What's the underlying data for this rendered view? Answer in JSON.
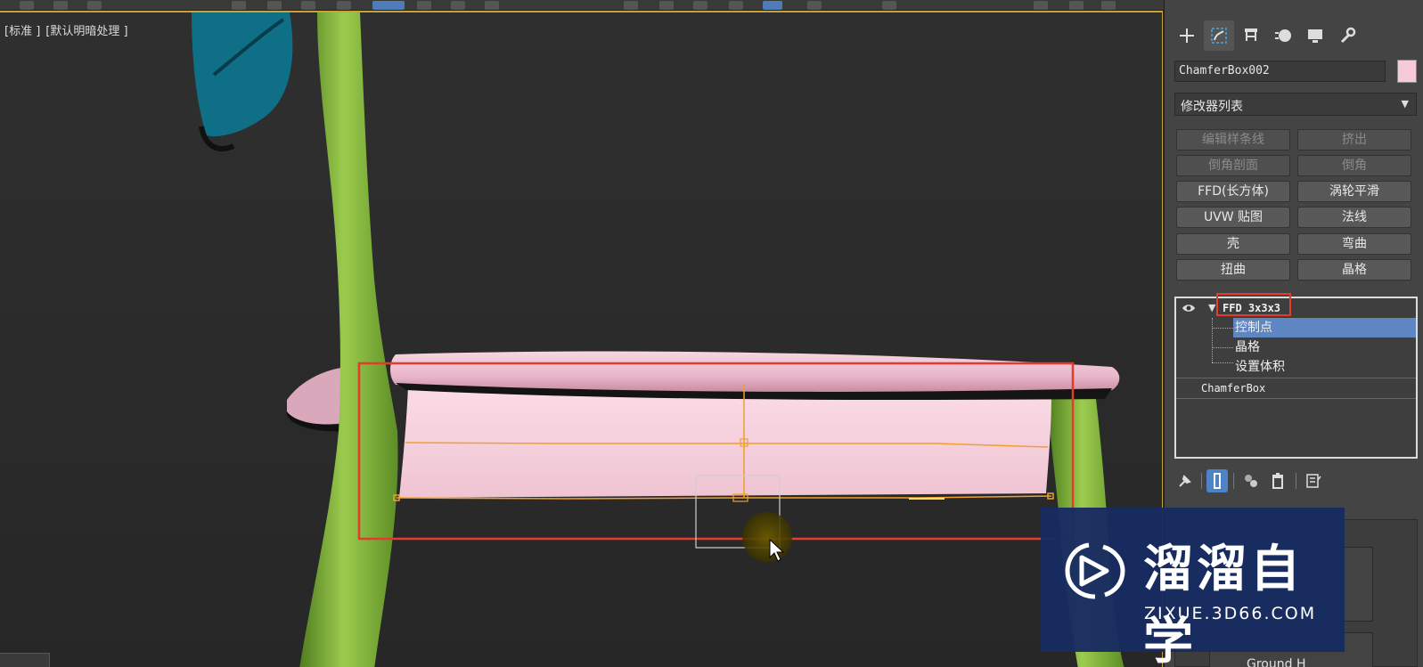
{
  "viewport": {
    "labels": [
      "[标准 ]",
      "[默认明暗处理 ]"
    ]
  },
  "command_panel": {
    "tabs": [
      {
        "name": "create",
        "icon": "plus-icon"
      },
      {
        "name": "modify",
        "icon": "modify-icon",
        "active": true
      },
      {
        "name": "hierarchy",
        "icon": "hierarchy-icon"
      },
      {
        "name": "motion",
        "icon": "motion-icon"
      },
      {
        "name": "display",
        "icon": "display-icon"
      },
      {
        "name": "utilities",
        "icon": "wrench-icon"
      }
    ],
    "object_name": "ChamferBox002",
    "object_color": "#f7cad7",
    "modifier_list": "修改器列表",
    "modifier_buttons": [
      {
        "label": "编辑样条线",
        "enabled": false
      },
      {
        "label": "挤出",
        "enabled": false
      },
      {
        "label": "倒角剖面",
        "enabled": false
      },
      {
        "label": "倒角",
        "enabled": false
      },
      {
        "label": "FFD(长方体)",
        "enabled": true
      },
      {
        "label": "涡轮平滑",
        "enabled": true
      },
      {
        "label": "UVW 贴图",
        "enabled": true
      },
      {
        "label": "法线",
        "enabled": true
      },
      {
        "label": "壳",
        "enabled": true
      },
      {
        "label": "弯曲",
        "enabled": true
      },
      {
        "label": "扭曲",
        "enabled": true
      },
      {
        "label": "晶格",
        "enabled": true
      }
    ],
    "stack": {
      "modifier": "FFD 3x3x3",
      "subobjects": [
        "控制点",
        "晶格",
        "设置体积"
      ],
      "selected_subobject": "控制点",
      "base": "ChamferBox"
    },
    "lower_label": "Ground H"
  },
  "watermark": {
    "title": "溜溜自学",
    "url": "ZIXUE.3D66.COM"
  },
  "colors": {
    "accent_blue": "#5e86c2",
    "highlight_red": "#e43b2f",
    "ffd_orange": "#f0a02c",
    "chair_green": "#7fb03a",
    "seat_pink": "#f4d1dd"
  }
}
